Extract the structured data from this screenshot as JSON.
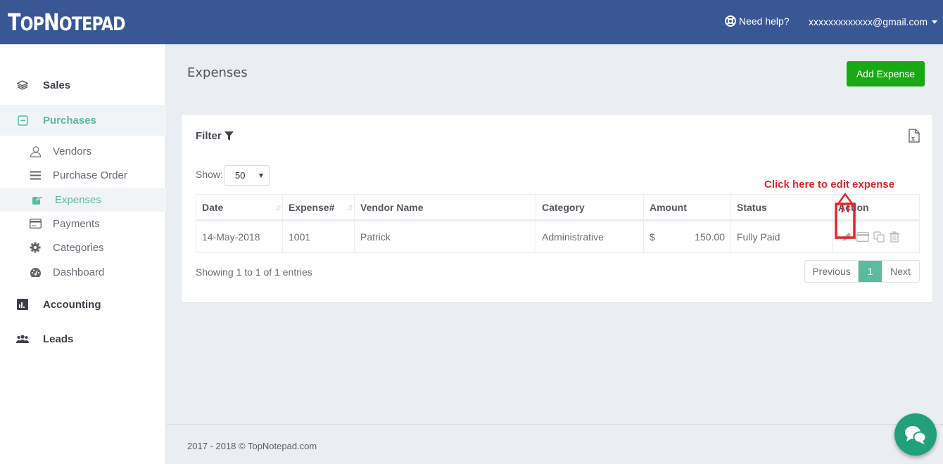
{
  "header": {
    "logo": {
      "t": "T",
      "op": "OP",
      "n": "N",
      "otepad": "OTEPAD"
    },
    "help_label": "Need help?",
    "account_email": "xxxxxxxxxxxxx@gmail.com"
  },
  "sidebar": {
    "sales": "Sales",
    "purchases": "Purchases",
    "sub_items": [
      {
        "label": "Vendors",
        "icon": "user-icon"
      },
      {
        "label": "Purchase Order",
        "icon": "list-icon"
      },
      {
        "label": "Expenses",
        "icon": "share-icon",
        "active": true
      },
      {
        "label": "Payments",
        "icon": "credit-card-icon"
      },
      {
        "label": "Categories",
        "icon": "gear-icon"
      },
      {
        "label": "Dashboard",
        "icon": "dashboard-icon"
      }
    ],
    "accounting": "Accounting",
    "leads": "Leads"
  },
  "main": {
    "title": "Expenses",
    "add_button": "Add Expense",
    "filter_label": "Filter",
    "show_label": "Show:",
    "page_size": "50",
    "table": {
      "headers": [
        "Date",
        "Expense#",
        "Vendor Name",
        "Category",
        "Amount",
        "Status",
        "Action"
      ],
      "rows": [
        {
          "date": "14-May-2018",
          "expense_no": "1001",
          "vendor": "Patrick",
          "category": "Administrative",
          "currency": "$",
          "amount": "150.00",
          "status": "Fully Paid"
        }
      ]
    },
    "showing": "Showing 1 to 1 of 1 entries",
    "pagination": {
      "previous": "Previous",
      "current": "1",
      "next": "Next"
    }
  },
  "annotation": {
    "text": "Click here to edit expense",
    "color": "#e8232c"
  },
  "footer": {
    "text": "2017 - 2018 © TopNotepad.com"
  },
  "colors": {
    "header_bg": "#3a5795",
    "accent": "#5bbb9d",
    "add_button": "#19a915",
    "chat": "#22a07c"
  }
}
